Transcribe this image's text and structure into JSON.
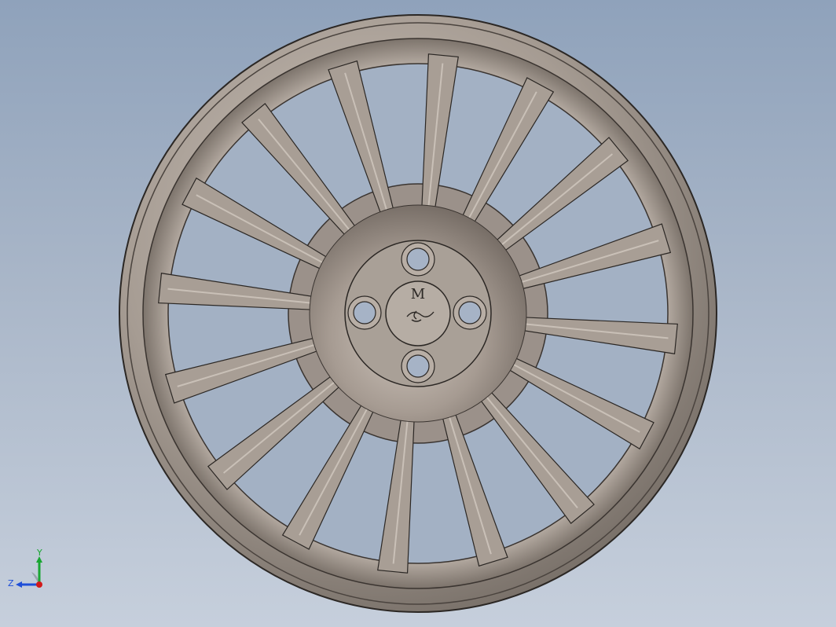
{
  "model": {
    "name": "alloy-wheel",
    "hub_logo_letter": "M",
    "spoke_count": 16,
    "lug_holes": 4
  },
  "triad": {
    "x_label": "",
    "y_label": "Y",
    "z_label": "Z"
  },
  "colors": {
    "background_top": "#8fa2bb",
    "background_bottom": "#c6cfdc",
    "metal_light": "#c8beb6",
    "metal_mid": "#9f958d",
    "metal_dark": "#5e5751",
    "edge": "#2b2724",
    "axis_x": "#d21a1a",
    "axis_y": "#19a632",
    "axis_z": "#1f4fd8"
  }
}
